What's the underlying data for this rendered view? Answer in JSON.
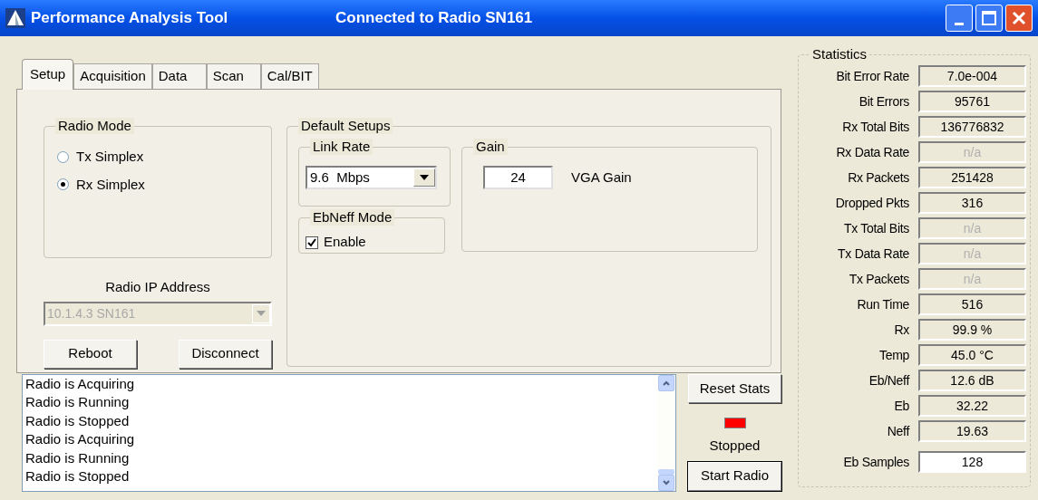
{
  "window": {
    "title": "Performance Analysis Tool",
    "subtitle": "Connected to Radio SN161"
  },
  "tabs": [
    {
      "label": "Setup",
      "selected": true
    },
    {
      "label": "Acquisition",
      "selected": false
    },
    {
      "label": "Data",
      "selected": false
    },
    {
      "label": "Scan",
      "selected": false
    },
    {
      "label": "Cal/BIT",
      "selected": false
    }
  ],
  "radio_mode": {
    "title": "Radio Mode",
    "options": [
      {
        "label": "Tx Simplex",
        "selected": false
      },
      {
        "label": "Rx Simplex",
        "selected": true
      }
    ]
  },
  "radio_ip": {
    "label": "Radio IP Address",
    "value": "10.1.4.3  SN161",
    "disabled": true
  },
  "buttons": {
    "reboot": "Reboot",
    "disconnect": "Disconnect",
    "reset_stats": "Reset Stats",
    "start_radio": {
      "label": "Start Radio",
      "default": true
    }
  },
  "default_setups": {
    "title": "Default Setups",
    "link_rate": {
      "title": "Link Rate",
      "value": "9.6  Mbps"
    },
    "ebneff_mode": {
      "title": "EbNeff Mode",
      "label": "Enable",
      "checked": true
    },
    "gain": {
      "title": "Gain",
      "value": "24",
      "label": "VGA Gain"
    }
  },
  "log": [
    "Radio is Acquiring",
    "Radio is Running",
    "Radio is Stopped",
    "Radio is Acquiring",
    "Radio is Running",
    "Radio is Stopped"
  ],
  "radio_status": {
    "label": "Stopped",
    "color": "#ff0000"
  },
  "statistics": {
    "title": "Statistics",
    "items": [
      {
        "label": "Bit Error Rate",
        "value": "7.0e-004",
        "disabled": false,
        "editable": false
      },
      {
        "label": "Bit Errors",
        "value": "95761",
        "disabled": false,
        "editable": false
      },
      {
        "label": "Rx Total Bits",
        "value": "136776832",
        "disabled": false,
        "editable": false
      },
      {
        "label": "Rx Data Rate",
        "value": "n/a",
        "disabled": true,
        "editable": false
      },
      {
        "label": "Rx Packets",
        "value": "251428",
        "disabled": false,
        "editable": false
      },
      {
        "label": "Dropped Pkts",
        "value": "316",
        "disabled": false,
        "editable": false
      },
      {
        "label": "Tx Total Bits",
        "value": "n/a",
        "disabled": true,
        "editable": false
      },
      {
        "label": "Tx Data Rate",
        "value": "n/a",
        "disabled": true,
        "editable": false
      },
      {
        "label": "Tx Packets",
        "value": "n/a",
        "disabled": true,
        "editable": false
      },
      {
        "label": "Run Time",
        "value": "516",
        "disabled": false,
        "editable": false
      },
      {
        "label": "Rx",
        "value": "99.9 %",
        "disabled": false,
        "editable": false
      },
      {
        "label": "Temp",
        "value": "45.0 °C",
        "disabled": false,
        "editable": false
      },
      {
        "label": "Eb/Neff",
        "value": "12.6 dB",
        "disabled": false,
        "editable": false
      },
      {
        "label": "Eb",
        "value": "32.22",
        "disabled": false,
        "editable": false
      },
      {
        "label": "Neff",
        "value": "19.63",
        "disabled": false,
        "editable": false
      },
      {
        "label": "Eb Samples",
        "value": "128",
        "disabled": false,
        "editable": true
      }
    ]
  }
}
